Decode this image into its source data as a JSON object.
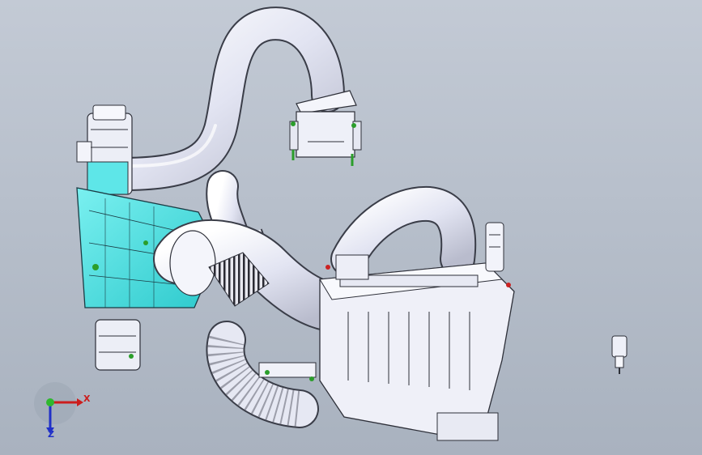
{
  "viewport": {
    "background_top": "#c3cad5",
    "background_bottom": "#a9b2bf",
    "highlight_color": "#40e0e0",
    "part_color": "#e6e8f4"
  },
  "triad": {
    "x_label": "X",
    "z_label": "Z",
    "x_color": "#cc1d1d",
    "y_color": "#2fb82f",
    "z_color": "#2030c8"
  }
}
